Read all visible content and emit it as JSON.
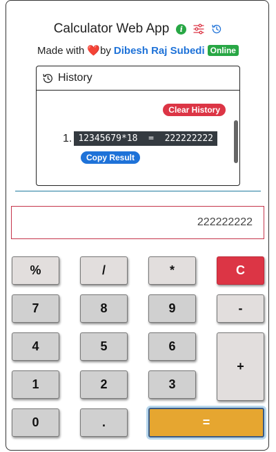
{
  "header": {
    "title": "Calculator Web App",
    "made_with": "Made with",
    "heart": "❤️",
    "by": "by",
    "author": "Dibesh Raj Subedi",
    "status": "Online",
    "icons": [
      "info-icon",
      "sliders-icon",
      "history-icon"
    ]
  },
  "history": {
    "title": "History",
    "clear_label": "Clear History",
    "entries": [
      {
        "index": "1.",
        "expression": "12345679*18  =  222222222",
        "copy_label": "Copy Result"
      }
    ]
  },
  "display": {
    "value": "222222222"
  },
  "keys": {
    "percent": "%",
    "divide": "/",
    "multiply": "*",
    "clear": "C",
    "seven": "7",
    "eight": "8",
    "nine": "9",
    "minus": "-",
    "four": "4",
    "five": "5",
    "six": "6",
    "plus": "+",
    "one": "1",
    "two": "2",
    "three": "3",
    "zero": "0",
    "dot": ".",
    "equals": "="
  },
  "colors": {
    "green": "#28a745",
    "red": "#dc3545",
    "blue": "#1e72d8",
    "orange": "#e6a630",
    "display_border": "#c4334a"
  }
}
